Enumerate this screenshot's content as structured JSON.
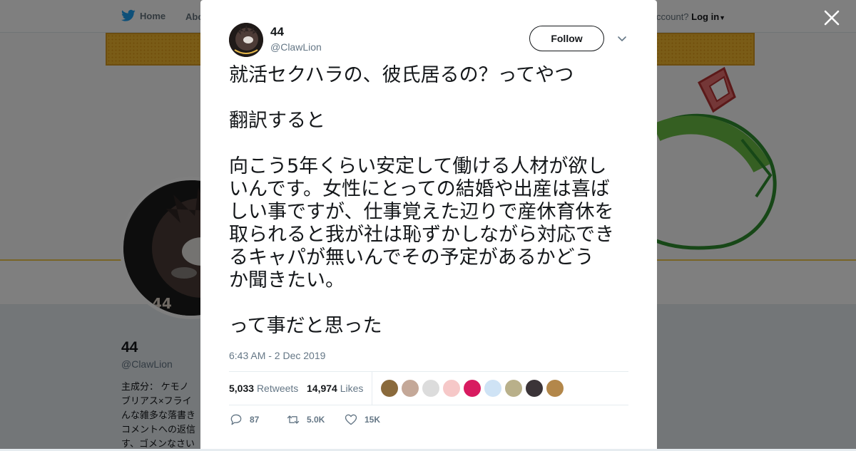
{
  "nav": {
    "home_label": "Home",
    "about_label": "Abo",
    "account_prompt": "ccount?",
    "login_label": "Log in"
  },
  "profile": {
    "name": "44",
    "handle": "@ClawLion",
    "bio_lines": [
      "主成分： ケモノ",
      "ブリアス×フライ",
      "んな雑多な落書き",
      "コメントへの返信",
      "す、ゴメンなさい"
    ]
  },
  "tweet": {
    "author_name": "44",
    "author_handle": "@ClawLion",
    "follow_label": "Follow",
    "text_lines": [
      "就活セクハラの、彼氏居るの？ってやつ",
      "",
      "翻訳すると",
      "",
      "向こう5年くらい安定して働ける人材が欲し",
      "いんです。女性にとっての結婚や出産は喜ば",
      "しい事ですが、仕事覚えた辺りで産休育休を",
      "取られると我が社は恥ずかしながら対応でき",
      "るキャパが無いんでその予定があるかどう",
      "か聞きたい。",
      "",
      "って事だと思った"
    ],
    "timestamp": "6:43 AM - 2 Dec 2019",
    "retweets_count": "5,033",
    "retweets_label": "Retweets",
    "likes_count": "14,974",
    "likes_label": "Likes",
    "reply_count": "87",
    "retweet_action_count": "5.0K",
    "like_action_count": "15K",
    "liker_colors": [
      "#8a6a3c",
      "#c4a898",
      "#dcdcdc",
      "#f6c8c8",
      "#d81b60",
      "#cfe3f5",
      "#b9b08a",
      "#3b3438",
      "#b3874a"
    ]
  },
  "colors": {
    "brand": "#1da1f2",
    "muted": "#657786",
    "text": "#14171a"
  },
  "icons": [
    "twitter-bird-icon",
    "close-icon",
    "chevron-down-icon",
    "reply-icon",
    "retweet-icon",
    "heart-icon"
  ]
}
